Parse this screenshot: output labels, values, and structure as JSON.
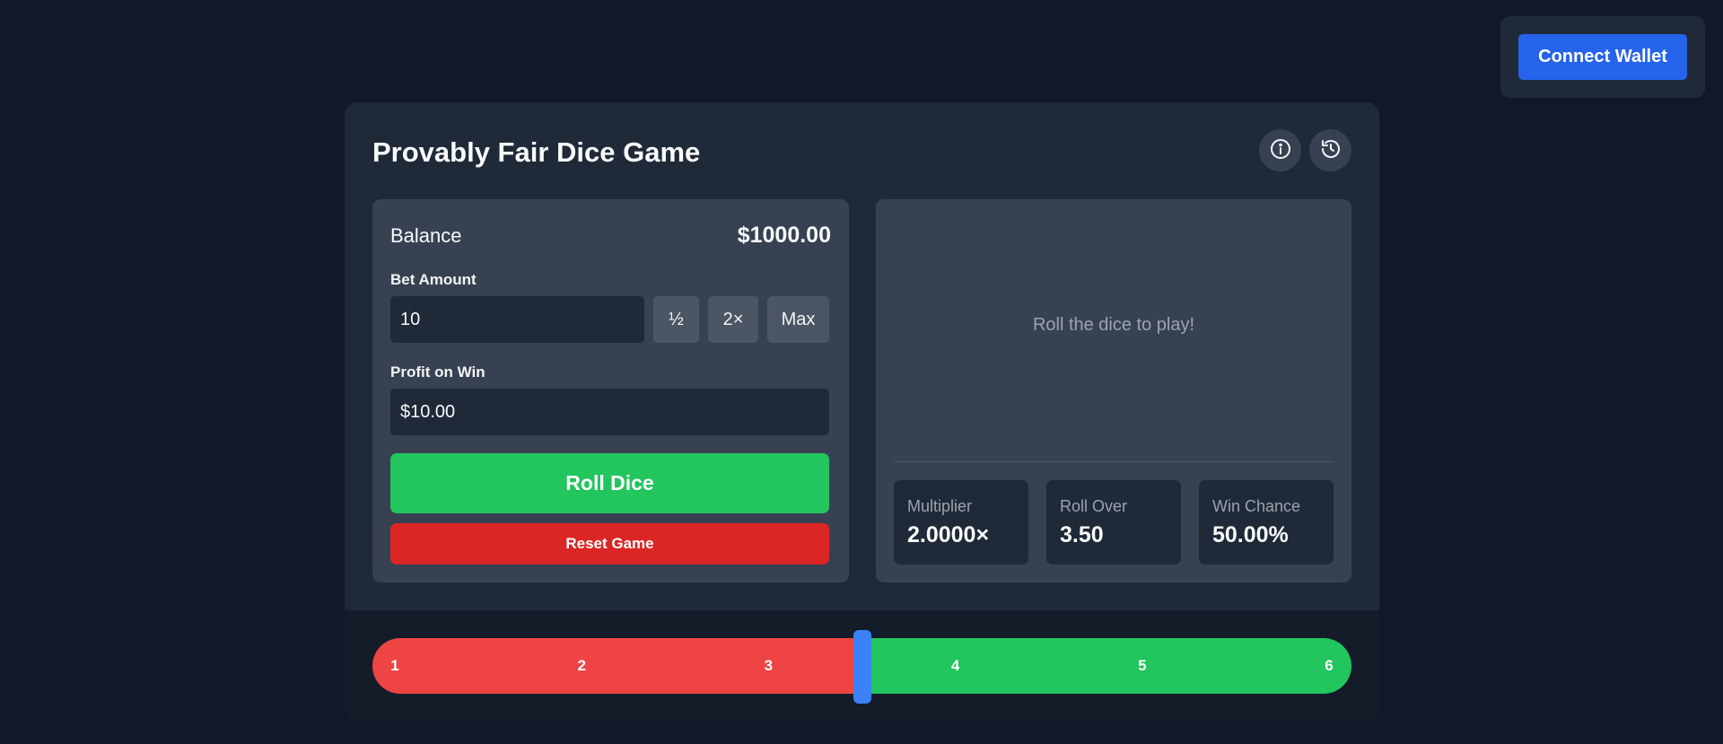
{
  "header": {
    "connect_wallet_label": "Connect Wallet"
  },
  "game": {
    "title": "Provably Fair Dice Game",
    "info_icon": "info-icon",
    "history_icon": "history-icon"
  },
  "controls": {
    "balance_label": "Balance",
    "balance_value": "$1000.00",
    "bet_amount_label": "Bet Amount",
    "bet_amount_value": "10",
    "half_label": "½",
    "double_label": "2×",
    "max_label": "Max",
    "profit_label": "Profit on Win",
    "profit_value": "$10.00",
    "roll_label": "Roll Dice",
    "reset_label": "Reset Game"
  },
  "result": {
    "placeholder": "Roll the dice to play!",
    "stats": [
      {
        "label": "Multiplier",
        "value": "2.0000×"
      },
      {
        "label": "Roll Over",
        "value": "3.50"
      },
      {
        "label": "Win Chance",
        "value": "50.00%"
      }
    ]
  },
  "slider": {
    "ticks": [
      "1",
      "2",
      "3",
      "4",
      "5",
      "6"
    ],
    "min": 1,
    "max": 6,
    "roll_over": 3.5,
    "lose_color": "#ef4444",
    "win_color": "#22c55e",
    "handle_color": "#3b82f6"
  }
}
